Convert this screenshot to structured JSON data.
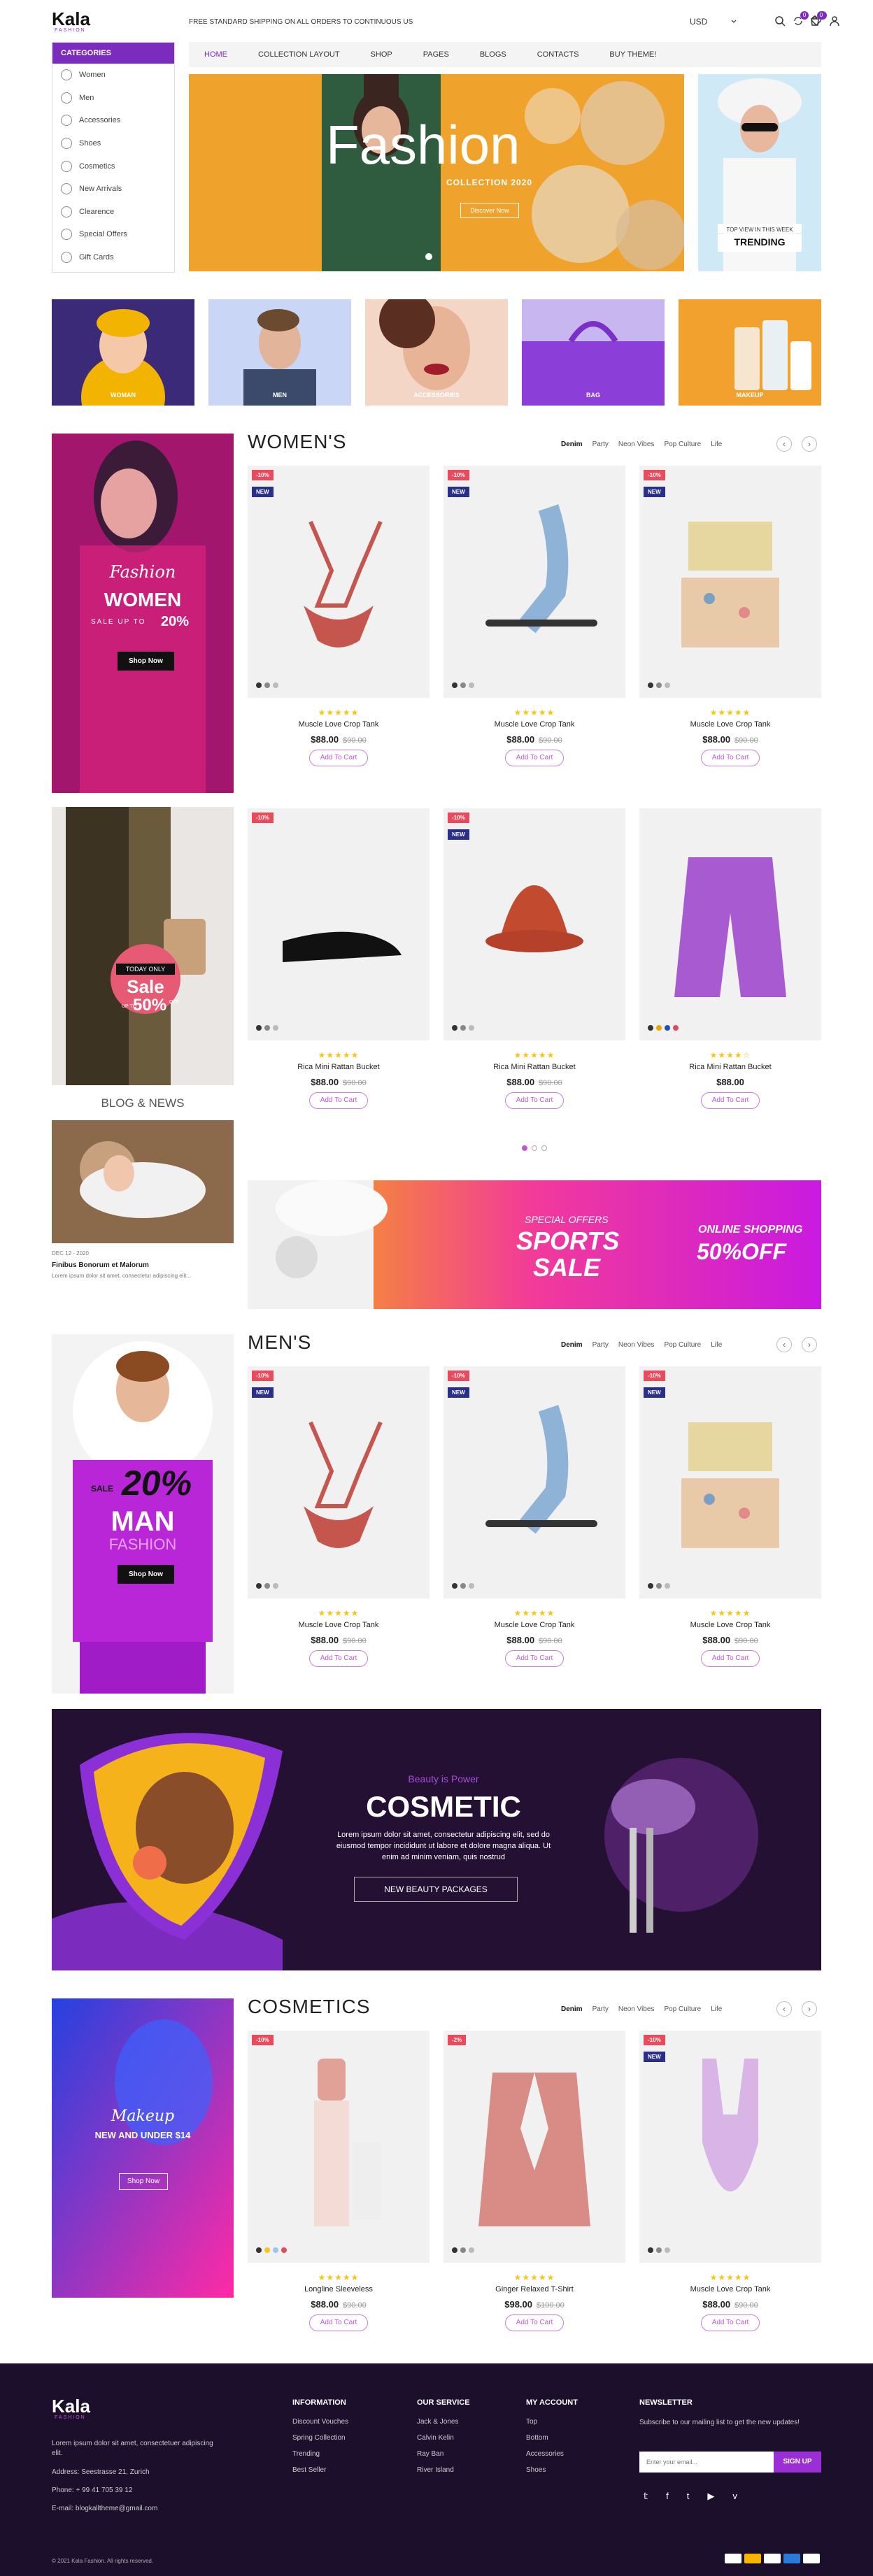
{
  "header": {
    "logo": "Kala",
    "logo_sub": "FASHION",
    "shipping": "FREE STANDARD SHIPPING ON ALL ORDERS TO CONTINUOUS US",
    "currency": "USD",
    "compare_count": "0",
    "wishlist_count": "0",
    "cart_count": "0"
  },
  "categories": {
    "title": "CATEGORIES",
    "items": [
      {
        "label": "Women",
        "icon": "dress-icon"
      },
      {
        "label": "Men",
        "icon": "shirt-icon"
      },
      {
        "label": "Accessories",
        "icon": "watch-icon"
      },
      {
        "label": "Shoes",
        "icon": "shoe-icon"
      },
      {
        "label": "Cosmetics",
        "icon": "lipstick-icon"
      },
      {
        "label": "New Arrivals",
        "icon": "tag-icon"
      },
      {
        "label": "Clearence",
        "icon": "percent-icon"
      },
      {
        "label": "Special Offers",
        "icon": "gift-icon"
      },
      {
        "label": "Gift Cards",
        "icon": "card-icon"
      }
    ]
  },
  "nav": [
    "HOME",
    "COLLECTION LAYOUT",
    "SHOP",
    "PAGES",
    "BLOGS",
    "CONTACTS",
    "BUY THEME!"
  ],
  "hero": {
    "title": "Fashion",
    "subtitle": "COLLECTION 2020",
    "button": "Discover Now"
  },
  "hero_side": {
    "line1": "TOP VIEW IN THIS WEEK",
    "line2": "TRENDING"
  },
  "category_tiles": [
    "WOMAN",
    "MEN",
    "ACCESSORIES",
    "BAG",
    "MAKEUP"
  ],
  "women": {
    "title": "WOMEN'S",
    "tabs": [
      "Denim",
      "Party",
      "Neon Vibes",
      "Pop Culture",
      "Life"
    ],
    "promo": {
      "script": "Fashion",
      "title": "WOMEN",
      "sale": "SALE UP TO",
      "pct": "20%",
      "button": "Shop Now"
    },
    "products": [
      {
        "name": "Muscle Love Crop Tank",
        "price": "$88.00",
        "old": "$90.00",
        "sale": "-10%",
        "new": "NEW",
        "stars": "★★★★★",
        "cart": "Add To Cart"
      },
      {
        "name": "Muscle Love Crop Tank",
        "price": "$88.00",
        "old": "$90.00",
        "sale": "-10%",
        "new": "NEW",
        "stars": "★★★★★",
        "cart": "Add To Cart"
      },
      {
        "name": "Muscle Love Crop Tank",
        "price": "$88.00",
        "old": "$90.00",
        "sale": "-10%",
        "new": "NEW",
        "stars": "★★★★★",
        "cart": "Add To Cart"
      },
      {
        "name": "Rica Mini Rattan Bucket",
        "price": "$88.00",
        "old": "$90.00",
        "sale": "-10%",
        "new": "",
        "stars": "★★★★★",
        "cart": "Add To Cart"
      },
      {
        "name": "Rica Mini Rattan Bucket",
        "price": "$88.00",
        "old": "$90.00",
        "sale": "-10%",
        "new": "NEW",
        "stars": "★★★★★",
        "cart": "Add To Cart"
      },
      {
        "name": "Rica Mini Rattan Bucket",
        "price": "$88.00",
        "old": "",
        "sale": "",
        "new": "",
        "stars": "★★★★☆",
        "cart": "Add To Cart"
      }
    ]
  },
  "sale_banner": {
    "tag": "TODAY ONLY",
    "title": "Sale",
    "upto": "UP TO",
    "pct": "50%",
    "off": "OFF"
  },
  "blog": {
    "title": "BLOG & NEWS",
    "date": "DEC 12 - 2020",
    "post_title": "Finibus Bonorum et Malorum",
    "excerpt": "Lorem ipsum dolor sit amet, consectetur adipiscing elit..."
  },
  "sports": {
    "special": "SPECIAL OFFERS",
    "title1": "SPORTS",
    "title2": "SALE",
    "online": "ONLINE SHOPPING",
    "pct": "50%OFF"
  },
  "men": {
    "title": "MEN'S",
    "tabs": [
      "Denim",
      "Party",
      "Neon Vibes",
      "Pop Culture",
      "Life"
    ],
    "promo": {
      "sale": "SALE",
      "pct": "20%",
      "title": "MAN",
      "sub": "FASHION",
      "button": "Shop Now"
    },
    "products": [
      {
        "name": "Muscle Love Crop Tank",
        "price": "$88.00",
        "old": "$90.00",
        "sale": "-10%",
        "new": "NEW",
        "stars": "★★★★★",
        "cart": "Add To Cart"
      },
      {
        "name": "Muscle Love Crop Tank",
        "price": "$88.00",
        "old": "$90.00",
        "sale": "-10%",
        "new": "NEW",
        "stars": "★★★★★",
        "cart": "Add To Cart"
      },
      {
        "name": "Muscle Love Crop Tank",
        "price": "$88.00",
        "old": "$90.00",
        "sale": "-10%",
        "new": "NEW",
        "stars": "★★★★★",
        "cart": "Add To Cart"
      }
    ]
  },
  "cosmetic_banner": {
    "kicker": "Beauty is Power",
    "title": "COSMETIC",
    "text": "Lorem ipsum dolor sit amet, consectetur adipiscing elit, sed do eiusmod tempor incididunt ut labore et dolore magna aliqua. Ut enim ad minim veniam, quis nostrud",
    "button": "NEW BEAUTY PACKAGES"
  },
  "cosmetics": {
    "title": "COSMETICS",
    "tabs": [
      "Denim",
      "Party",
      "Neon Vibes",
      "Pop Culture",
      "Life"
    ],
    "promo": {
      "script": "Makeup",
      "title": "NEW AND UNDER $14",
      "button": "Shop Now"
    },
    "products": [
      {
        "name": "Longline Sleeveless",
        "price": "$88.00",
        "old": "$90.00",
        "sale": "-10%",
        "new": "",
        "stars": "★★★★★",
        "cart": "Add To Cart"
      },
      {
        "name": "Ginger Relaxed T-Shirt",
        "price": "$98.00",
        "old": "$100.00",
        "sale": "-2%",
        "new": "",
        "stars": "★★★★★",
        "cart": "Add To Cart"
      },
      {
        "name": "Muscle Love Crop Tank",
        "price": "$88.00",
        "old": "$90.00",
        "sale": "-10%",
        "new": "NEW",
        "stars": "★★★★★",
        "cart": "Add To Cart"
      }
    ]
  },
  "footer": {
    "logo": "Kala",
    "logo_sub": "FASHION",
    "about": "Lorem ipsum dolor sit amet, consectetuer adipiscing elit.",
    "address_label": "Address:",
    "address": "Seestrasse 21, Zurich",
    "phone_label": "Phone:",
    "phone": "+ 99 41 705 39 12",
    "email_label": "E-mail:",
    "email": "blogkalltheme@gmail.com",
    "information": {
      "title": "INFORMATION",
      "items": [
        "Discount Vouches",
        "Spring Collection",
        "Trending",
        "Best Seller"
      ]
    },
    "service": {
      "title": "OUR SERVICE",
      "items": [
        "Jack & Jones",
        "Calvin Kelin",
        "Ray Ban",
        "River Island"
      ]
    },
    "account": {
      "title": "MY ACCOUNT",
      "items": [
        "Top",
        "Bottom",
        "Accessories",
        "Shoes"
      ]
    },
    "newsletter": {
      "title": "NEWSLETTER",
      "text": "Subscribe to our mailing list to get the new updates!",
      "placeholder": "Enter your email...",
      "button": "SIGN UP"
    },
    "copyright": "© 2021 Kala Fashion. All rights reserved.",
    "social": [
      "twitter-icon",
      "facebook-icon",
      "tumblr-icon",
      "youtube-icon",
      "vimeo-icon"
    ],
    "payments": [
      "visa",
      "mastercard",
      "paypal",
      "amex",
      "discover"
    ]
  }
}
